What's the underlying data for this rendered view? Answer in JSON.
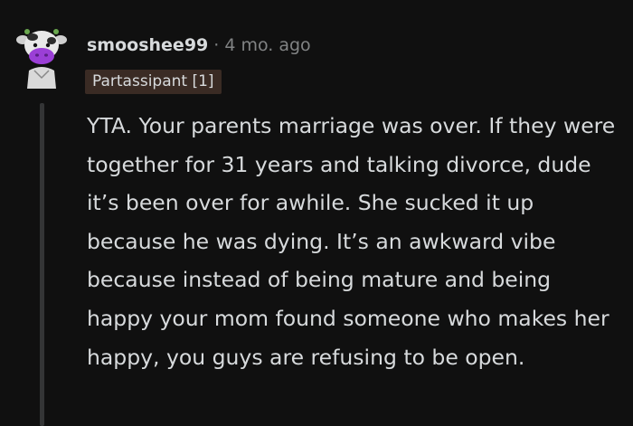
{
  "comment": {
    "username": "smooshee99",
    "separator": "·",
    "timestamp": "4 mo. ago",
    "flair": "Partassipant [1]",
    "avatar_icon": "cow-avatar-icon",
    "body": "YTA. Your parents marriage was over. If they were together for 31 years and talking divorce, dude it’s been over for awhile. She sucked it up because he was dying. It’s an awkward vibe because instead of being mature and being happy your mom found someone who makes her happy, you guys are refusing to be open."
  },
  "colors": {
    "background": "#101010",
    "text": "#d7dadc",
    "muted": "#818384",
    "flair_bg": "#3a2b24",
    "thread_line": "#343536",
    "avatar_accent": "#9b3fd6"
  }
}
